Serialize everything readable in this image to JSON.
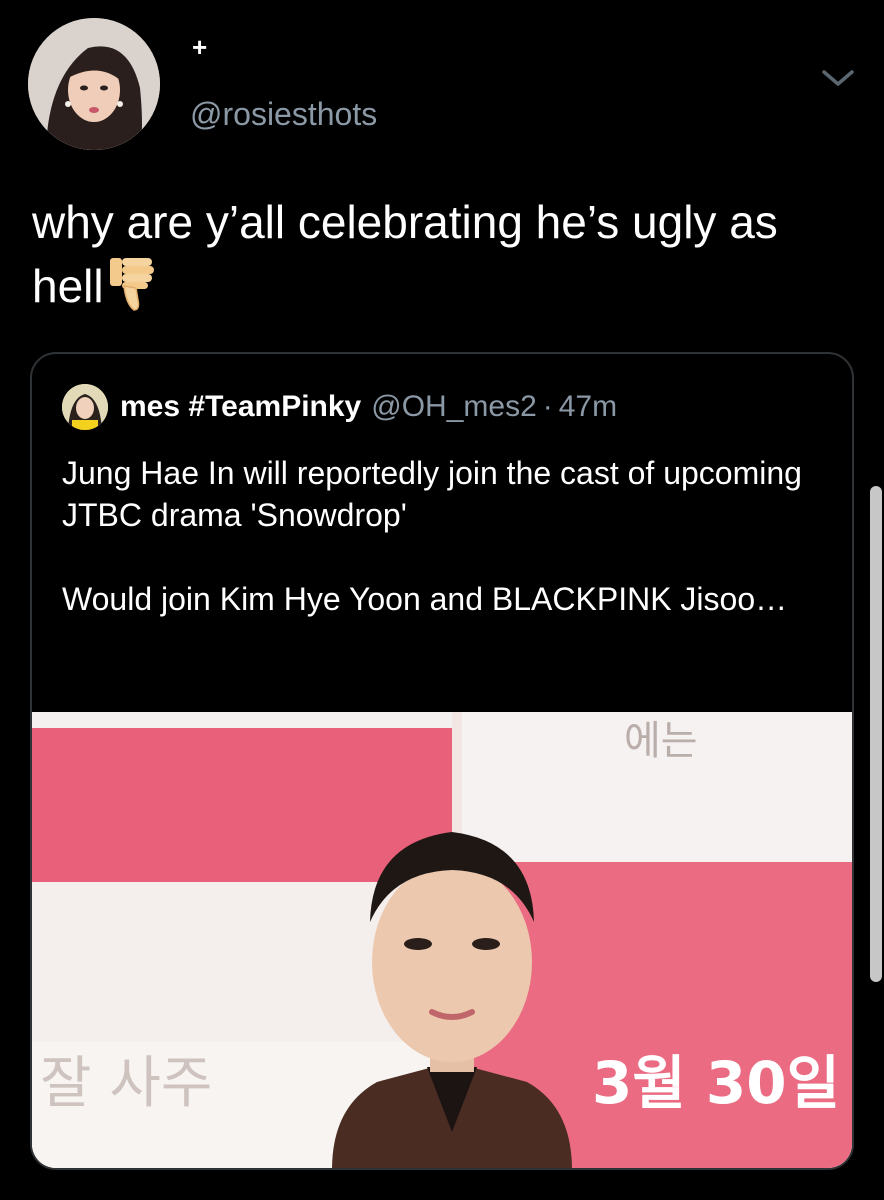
{
  "tweet": {
    "follow_plus": "+",
    "handle": "@rosiesthots",
    "text": "why are y’all celebrating he’s ugly as hell",
    "emoji": "thumbs-down-emoji",
    "avatar_icon": "profile-avatar"
  },
  "quoted_tweet": {
    "display_name": "mes #TeamPinky",
    "handle": "@OH_mes2",
    "separator": "·",
    "time": "47m",
    "paragraph_1": "Jung Hae In will reportedly join the cast of upcoming JTBC drama 'Snowdrop'",
    "paragraph_2": "Would join Kim Hye Yoon and BLACKPINK Jisoo…",
    "image_left_text": "잘 사주",
    "image_right_text": "3월 30일",
    "image_top_text": "에는"
  },
  "colors": {
    "background": "#000000",
    "text": "#ffffff",
    "secondary_text": "#8b98a5",
    "border": "#2f3336",
    "banner_pink": "#e8607a"
  }
}
